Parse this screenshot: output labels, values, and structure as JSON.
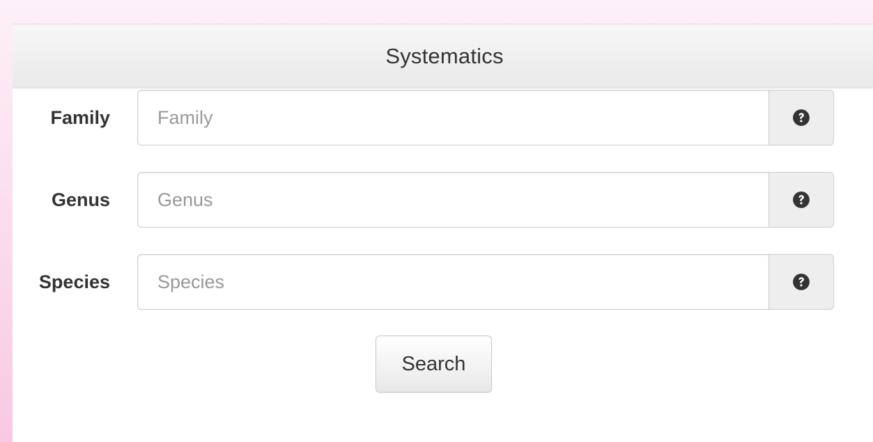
{
  "panel": {
    "title": "Systematics"
  },
  "fields": {
    "family": {
      "label": "Family",
      "placeholder": "Family",
      "value": "",
      "help_icon": "question-circle-icon"
    },
    "genus": {
      "label": "Genus",
      "placeholder": "Genus",
      "value": "",
      "help_icon": "question-circle-icon"
    },
    "species": {
      "label": "Species",
      "placeholder": "Species",
      "value": "",
      "help_icon": "question-circle-icon"
    }
  },
  "actions": {
    "search_label": "Search"
  },
  "colors": {
    "background_gradient_top": "#fdf0f8",
    "background_gradient_bottom": "#f8c9e2",
    "panel_heading": "#eeeeee",
    "addon": "#eeeeee",
    "icon": "#333333"
  }
}
